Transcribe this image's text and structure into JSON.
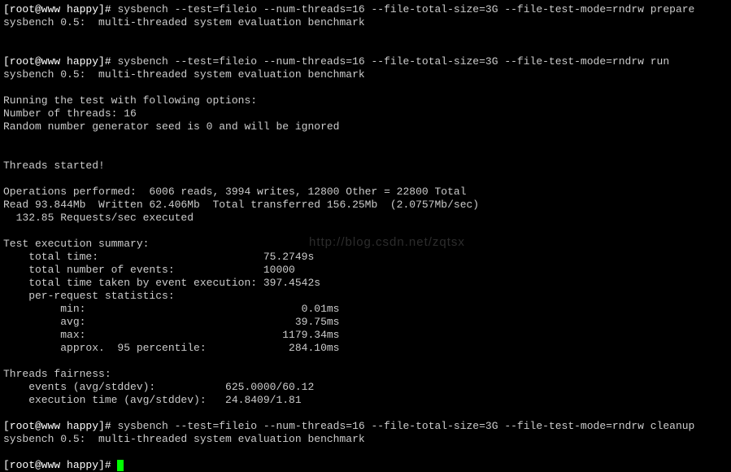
{
  "prompt": "[root@www happy]# ",
  "cmd1": "sysbench --test=fileio --num-threads=16 --file-total-size=3G --file-test-mode=rndrw prepare",
  "banner": "sysbench 0.5:  multi-threaded system evaluation benchmark",
  "cmd2": "sysbench --test=fileio --num-threads=16 --file-total-size=3G --file-test-mode=rndrw run",
  "opts_header": "Running the test with following options:",
  "threads_line": "Number of threads: 16",
  "rng_line": "Random number generator seed is 0 and will be ignored",
  "started": "Threads started!",
  "ops": "Operations performed:  6006 reads, 3994 writes, 12800 Other = 22800 Total",
  "read": "Read 93.844Mb  Written 62.406Mb  Total transferred 156.25Mb  (2.0757Mb/sec)",
  "reqs": "  132.85 Requests/sec executed",
  "summary_header": "Test execution summary:",
  "total_time": "    total time:                          75.2749s",
  "total_events": "    total number of events:              10000",
  "total_exec": "    total time taken by event execution: 397.4542s",
  "per_req": "    per-request statistics:",
  "stat_min": "         min:                                  0.01ms",
  "stat_avg": "         avg:                                 39.75ms",
  "stat_max": "         max:                               1179.34ms",
  "stat_p95": "         approx.  95 percentile:             284.10ms",
  "fair_header": "Threads fairness:",
  "fair_events": "    events (avg/stddev):           625.0000/60.12",
  "fair_exec": "    execution time (avg/stddev):   24.8409/1.81",
  "cmd3": "sysbench --test=fileio --num-threads=16 --file-total-size=3G --file-test-mode=rndrw cleanup",
  "watermark": "http://blog.csdn.net/zqtsx"
}
